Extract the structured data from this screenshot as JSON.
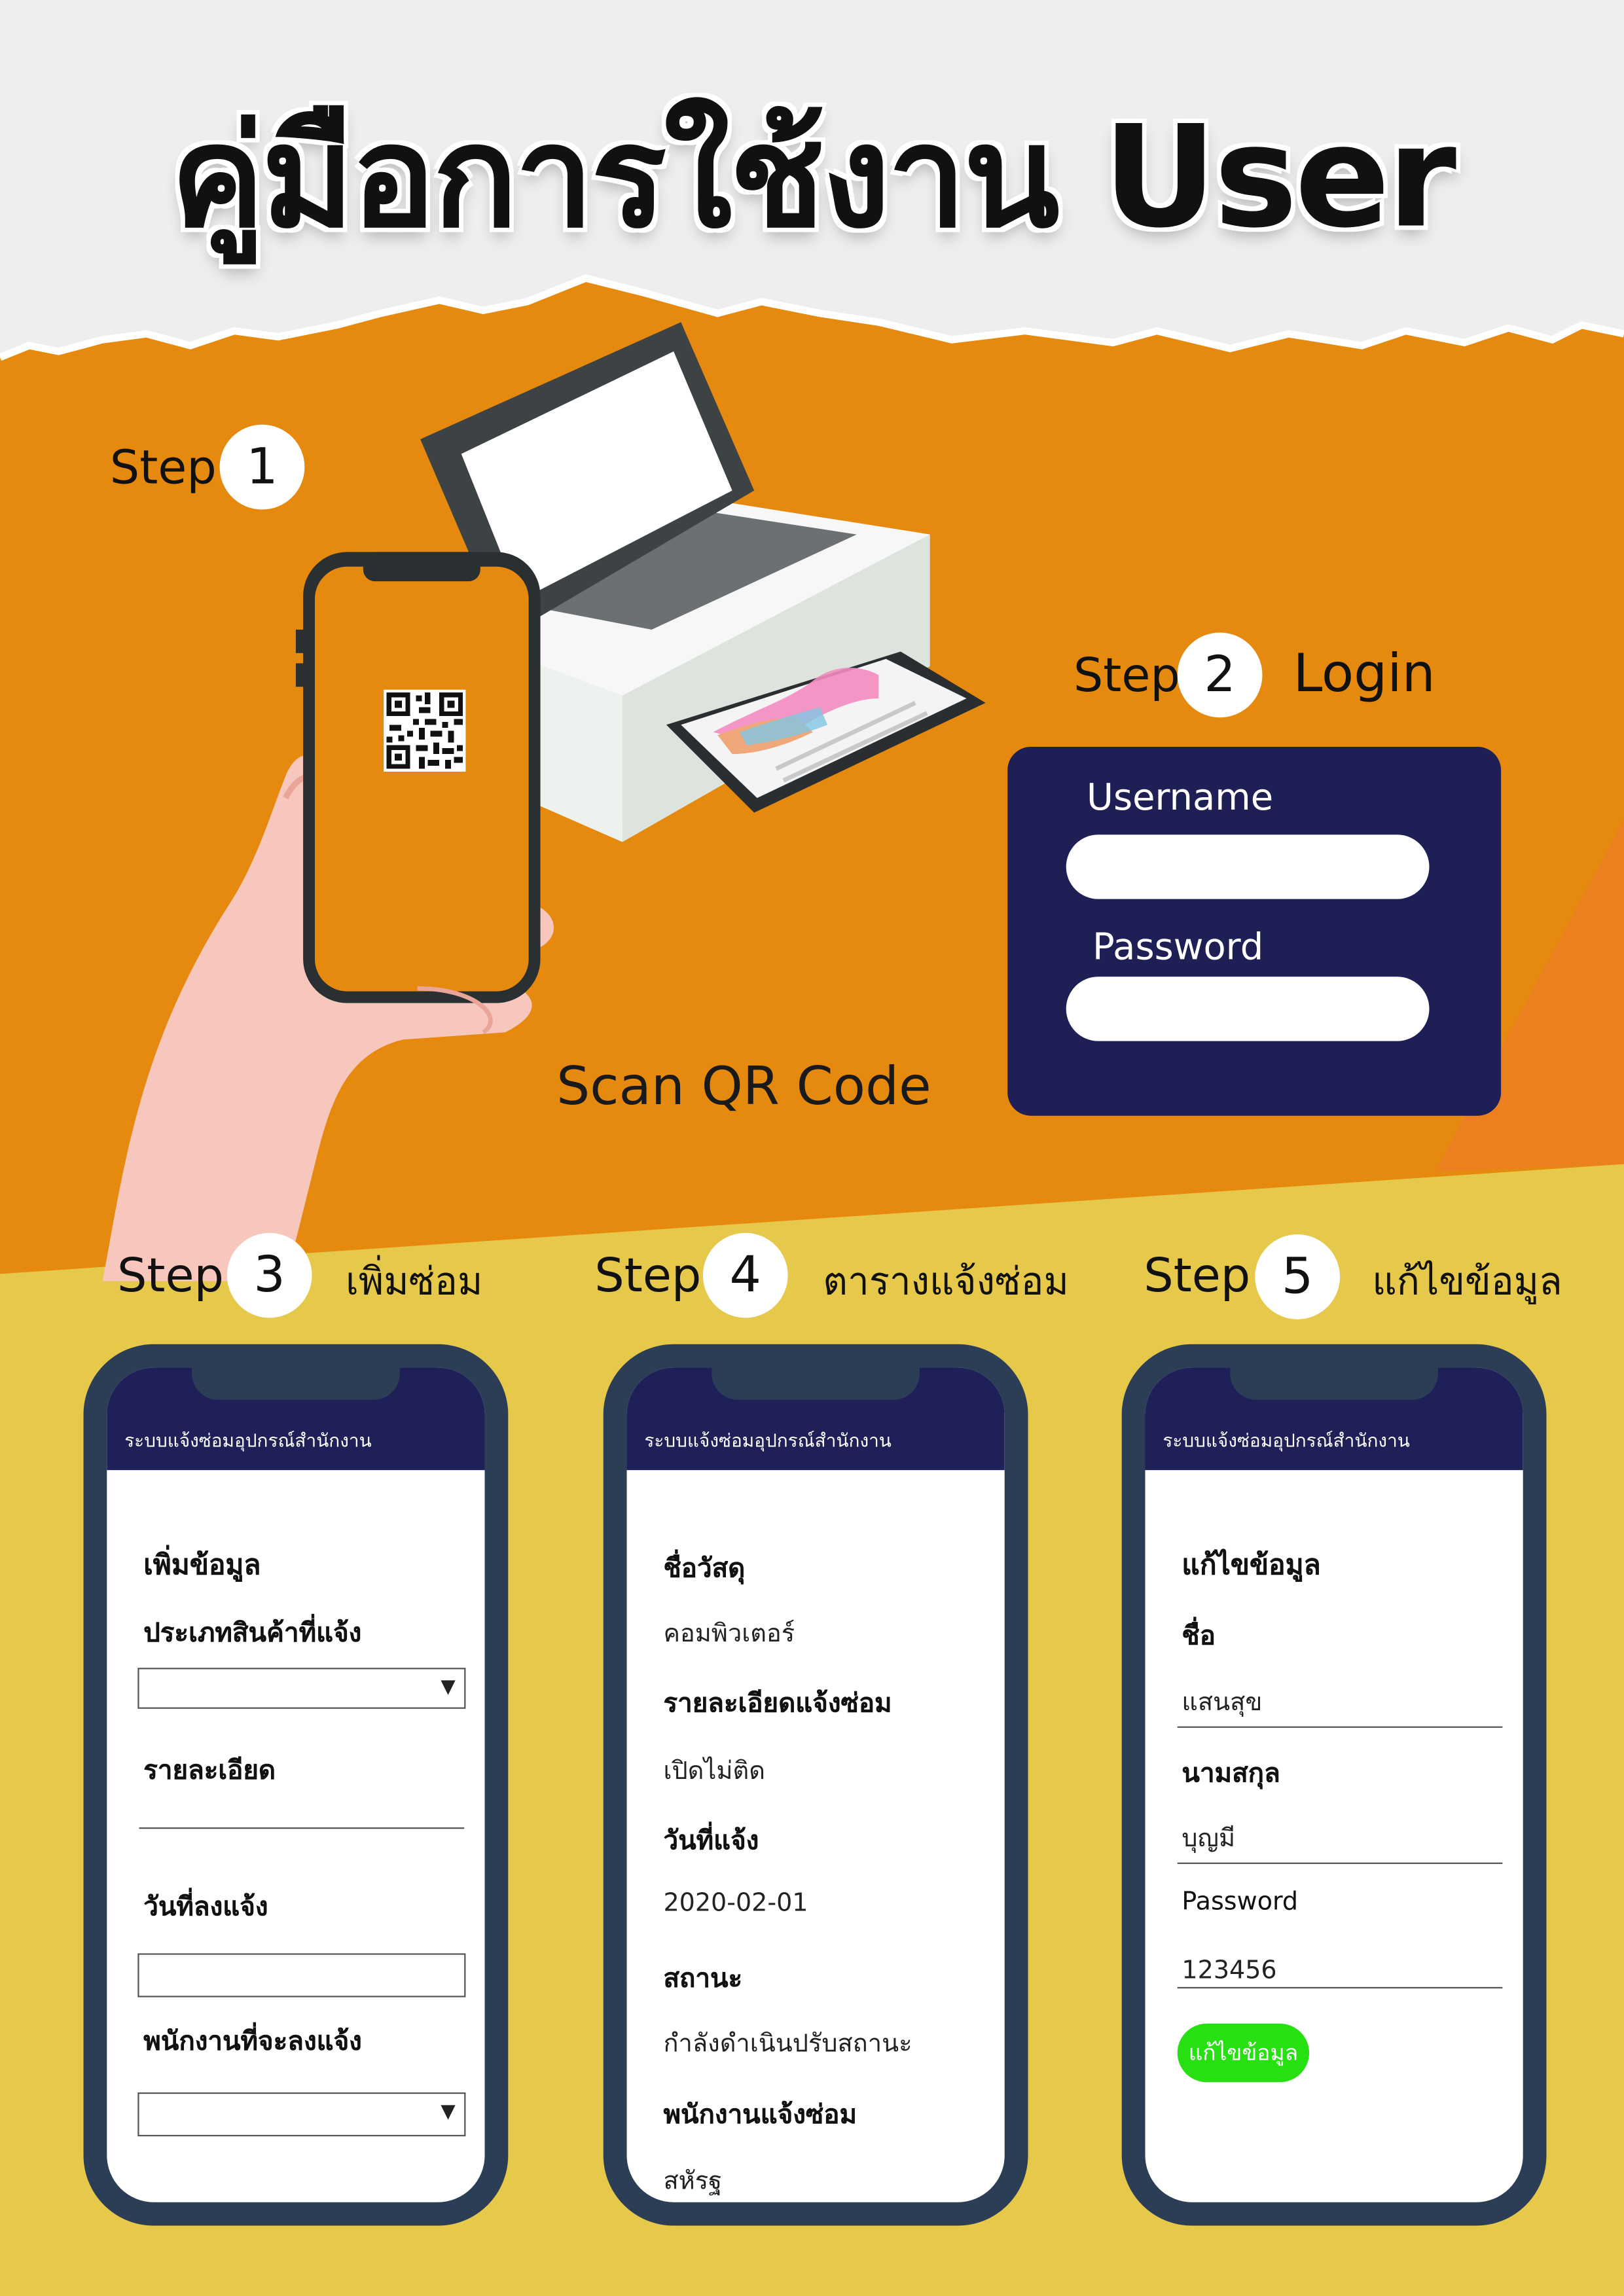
{
  "title": "คู่มือการใช้งาน User",
  "colors": {
    "paper": "#f2f2f2",
    "orange": "#e68a0f",
    "yellow": "#e6c84a",
    "navy": "#1e1f55",
    "phone_frame": "#2c3e56",
    "green_button": "#27e011"
  },
  "step_word": "Step",
  "step1": {
    "number": "1",
    "caption": "Scan QR Code"
  },
  "step2": {
    "number": "2",
    "title": "Login",
    "username_label": "Username",
    "password_label": "Password"
  },
  "step3": {
    "number": "3",
    "title": "เพิ่มซ่อม",
    "screen_header": "ระบบแจ้งซ่อมอุปกรณ์สำนักงาน",
    "form_title": "เพิ่มข้อมูล",
    "product_type_label": "ประเภทสินค้าที่แจ้ง",
    "detail_label": "รายละเอียด",
    "date_label": "วันที่ลงแจ้ง",
    "staff_label": "พนักงานที่จะลงแจ้ง",
    "dropdown_icon": "▼"
  },
  "step4": {
    "number": "4",
    "title": "ตารางแจ้งซ่อม",
    "screen_header": "ระบบแจ้งซ่อมอุปกรณ์สำนักงาน",
    "rows": [
      {
        "label": "ชื่อวัสดุ",
        "value": "คอมพิวเตอร์"
      },
      {
        "label": "รายละเอียดแจ้งซ่อม",
        "value": "เปิดไม่ติด"
      },
      {
        "label": "วันที่แจ้ง",
        "value": "2020-02-01"
      },
      {
        "label": "สถานะ",
        "value": "กำลังดำเนินปรับสถานะ"
      },
      {
        "label": "พนักงานแจ้งซ่อม",
        "value": "สหัรฐ"
      }
    ]
  },
  "step5": {
    "number": "5",
    "title": "แก้ไขข้อมูล",
    "screen_header": "ระบบแจ้งซ่อมอุปกรณ์สำนักงาน",
    "form_title": "แก้ไขข้อมูล",
    "name_label": "ชื่อ",
    "name_value": "แสนสุข",
    "surname_label": "นามสกุล",
    "surname_value": "บุญมี",
    "password_label": "Password",
    "password_value": "123456",
    "button_label": "แก้ไขข้อมูล"
  }
}
